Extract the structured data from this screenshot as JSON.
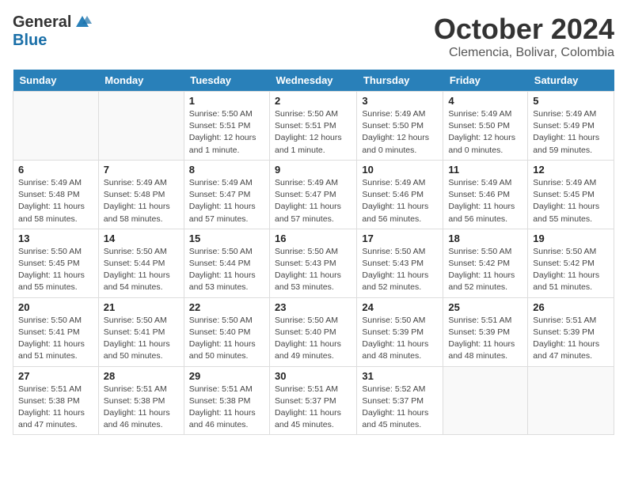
{
  "header": {
    "logo_general": "General",
    "logo_blue": "Blue",
    "title": "October 2024",
    "subtitle": "Clemencia, Bolivar, Colombia"
  },
  "days_of_week": [
    "Sunday",
    "Monday",
    "Tuesday",
    "Wednesday",
    "Thursday",
    "Friday",
    "Saturday"
  ],
  "weeks": [
    [
      {
        "day": "",
        "detail": ""
      },
      {
        "day": "",
        "detail": ""
      },
      {
        "day": "1",
        "detail": "Sunrise: 5:50 AM\nSunset: 5:51 PM\nDaylight: 12 hours and 1 minute."
      },
      {
        "day": "2",
        "detail": "Sunrise: 5:50 AM\nSunset: 5:51 PM\nDaylight: 12 hours and 1 minute."
      },
      {
        "day": "3",
        "detail": "Sunrise: 5:49 AM\nSunset: 5:50 PM\nDaylight: 12 hours and 0 minutes."
      },
      {
        "day": "4",
        "detail": "Sunrise: 5:49 AM\nSunset: 5:50 PM\nDaylight: 12 hours and 0 minutes."
      },
      {
        "day": "5",
        "detail": "Sunrise: 5:49 AM\nSunset: 5:49 PM\nDaylight: 11 hours and 59 minutes."
      }
    ],
    [
      {
        "day": "6",
        "detail": "Sunrise: 5:49 AM\nSunset: 5:48 PM\nDaylight: 11 hours and 58 minutes."
      },
      {
        "day": "7",
        "detail": "Sunrise: 5:49 AM\nSunset: 5:48 PM\nDaylight: 11 hours and 58 minutes."
      },
      {
        "day": "8",
        "detail": "Sunrise: 5:49 AM\nSunset: 5:47 PM\nDaylight: 11 hours and 57 minutes."
      },
      {
        "day": "9",
        "detail": "Sunrise: 5:49 AM\nSunset: 5:47 PM\nDaylight: 11 hours and 57 minutes."
      },
      {
        "day": "10",
        "detail": "Sunrise: 5:49 AM\nSunset: 5:46 PM\nDaylight: 11 hours and 56 minutes."
      },
      {
        "day": "11",
        "detail": "Sunrise: 5:49 AM\nSunset: 5:46 PM\nDaylight: 11 hours and 56 minutes."
      },
      {
        "day": "12",
        "detail": "Sunrise: 5:49 AM\nSunset: 5:45 PM\nDaylight: 11 hours and 55 minutes."
      }
    ],
    [
      {
        "day": "13",
        "detail": "Sunrise: 5:50 AM\nSunset: 5:45 PM\nDaylight: 11 hours and 55 minutes."
      },
      {
        "day": "14",
        "detail": "Sunrise: 5:50 AM\nSunset: 5:44 PM\nDaylight: 11 hours and 54 minutes."
      },
      {
        "day": "15",
        "detail": "Sunrise: 5:50 AM\nSunset: 5:44 PM\nDaylight: 11 hours and 53 minutes."
      },
      {
        "day": "16",
        "detail": "Sunrise: 5:50 AM\nSunset: 5:43 PM\nDaylight: 11 hours and 53 minutes."
      },
      {
        "day": "17",
        "detail": "Sunrise: 5:50 AM\nSunset: 5:43 PM\nDaylight: 11 hours and 52 minutes."
      },
      {
        "day": "18",
        "detail": "Sunrise: 5:50 AM\nSunset: 5:42 PM\nDaylight: 11 hours and 52 minutes."
      },
      {
        "day": "19",
        "detail": "Sunrise: 5:50 AM\nSunset: 5:42 PM\nDaylight: 11 hours and 51 minutes."
      }
    ],
    [
      {
        "day": "20",
        "detail": "Sunrise: 5:50 AM\nSunset: 5:41 PM\nDaylight: 11 hours and 51 minutes."
      },
      {
        "day": "21",
        "detail": "Sunrise: 5:50 AM\nSunset: 5:41 PM\nDaylight: 11 hours and 50 minutes."
      },
      {
        "day": "22",
        "detail": "Sunrise: 5:50 AM\nSunset: 5:40 PM\nDaylight: 11 hours and 50 minutes."
      },
      {
        "day": "23",
        "detail": "Sunrise: 5:50 AM\nSunset: 5:40 PM\nDaylight: 11 hours and 49 minutes."
      },
      {
        "day": "24",
        "detail": "Sunrise: 5:50 AM\nSunset: 5:39 PM\nDaylight: 11 hours and 48 minutes."
      },
      {
        "day": "25",
        "detail": "Sunrise: 5:51 AM\nSunset: 5:39 PM\nDaylight: 11 hours and 48 minutes."
      },
      {
        "day": "26",
        "detail": "Sunrise: 5:51 AM\nSunset: 5:39 PM\nDaylight: 11 hours and 47 minutes."
      }
    ],
    [
      {
        "day": "27",
        "detail": "Sunrise: 5:51 AM\nSunset: 5:38 PM\nDaylight: 11 hours and 47 minutes."
      },
      {
        "day": "28",
        "detail": "Sunrise: 5:51 AM\nSunset: 5:38 PM\nDaylight: 11 hours and 46 minutes."
      },
      {
        "day": "29",
        "detail": "Sunrise: 5:51 AM\nSunset: 5:38 PM\nDaylight: 11 hours and 46 minutes."
      },
      {
        "day": "30",
        "detail": "Sunrise: 5:51 AM\nSunset: 5:37 PM\nDaylight: 11 hours and 45 minutes."
      },
      {
        "day": "31",
        "detail": "Sunrise: 5:52 AM\nSunset: 5:37 PM\nDaylight: 11 hours and 45 minutes."
      },
      {
        "day": "",
        "detail": ""
      },
      {
        "day": "",
        "detail": ""
      }
    ]
  ]
}
